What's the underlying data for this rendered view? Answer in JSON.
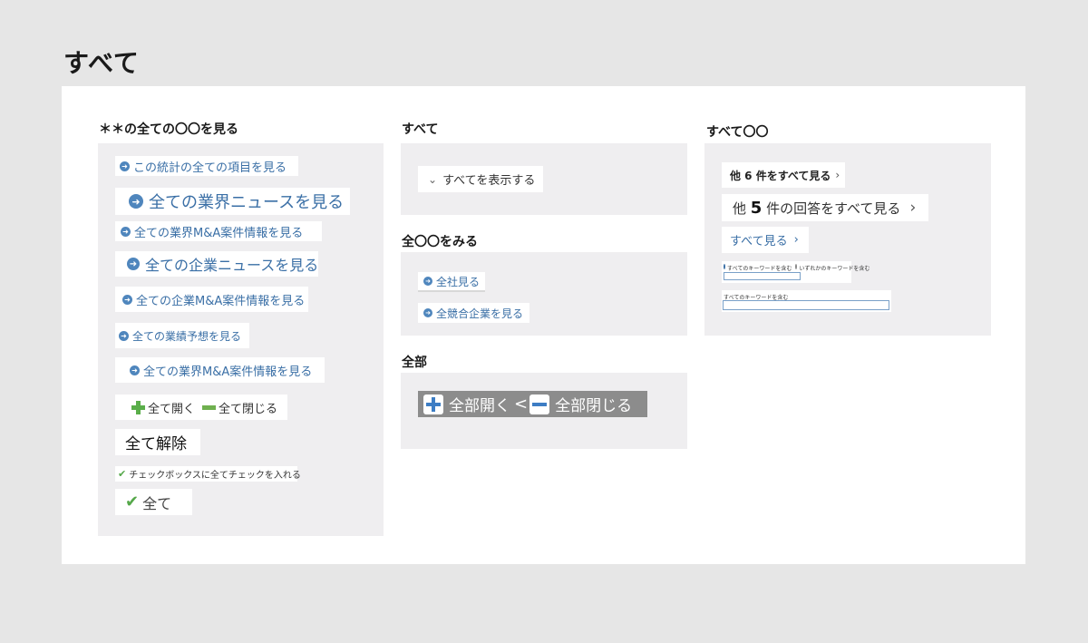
{
  "page": {
    "title": "すべて"
  },
  "col1": {
    "heading": "＊＊の全ての〇〇を見る",
    "items": [
      "この統計の全ての項目を見る",
      "全ての業界ニュースを見る",
      "全ての業界M&A案件情報を見る",
      "全ての企業ニュースを見る",
      "全ての企業M&A案件情報を見る",
      "全ての業績予想を見る",
      "全ての業界M&A案件情報を見る"
    ],
    "expand_all": "全て開く",
    "collapse_all": "全て閉じる",
    "clear_all": "全て解除",
    "check_all_text": "チェックボックスに全てチェックを入れる",
    "all_check": "全て"
  },
  "col2": {
    "heading_all": "すべて",
    "show_all": "すべてを表示する",
    "heading_all_items": "全〇〇をみる",
    "all_companies": "全社見る",
    "all_competitors": "全競合企業を見る",
    "heading_whole": "全部",
    "open_all": "全部開く",
    "close_all": "全部閉じる"
  },
  "col3": {
    "heading": "すべて〇〇",
    "view_all_6": "他 6 件をすべて見る",
    "answers_prefix": "他 ",
    "answers_count": "5",
    "answers_suffix": " 件の回答をすべて見る",
    "view_all": "すべて見る",
    "radio_all": "すべてのキーワードを含む",
    "radio_any": "いずれかのキーワードを含む",
    "field_label": "すべてのキーワードを含む"
  },
  "icons": {
    "arrow": "circle-arrow-right-icon",
    "chevron": "chevron-right-icon",
    "check": "check-icon"
  },
  "colors": {
    "link": "#3a6fa6",
    "accent": "#4f86bd",
    "green": "#5aae4a"
  }
}
